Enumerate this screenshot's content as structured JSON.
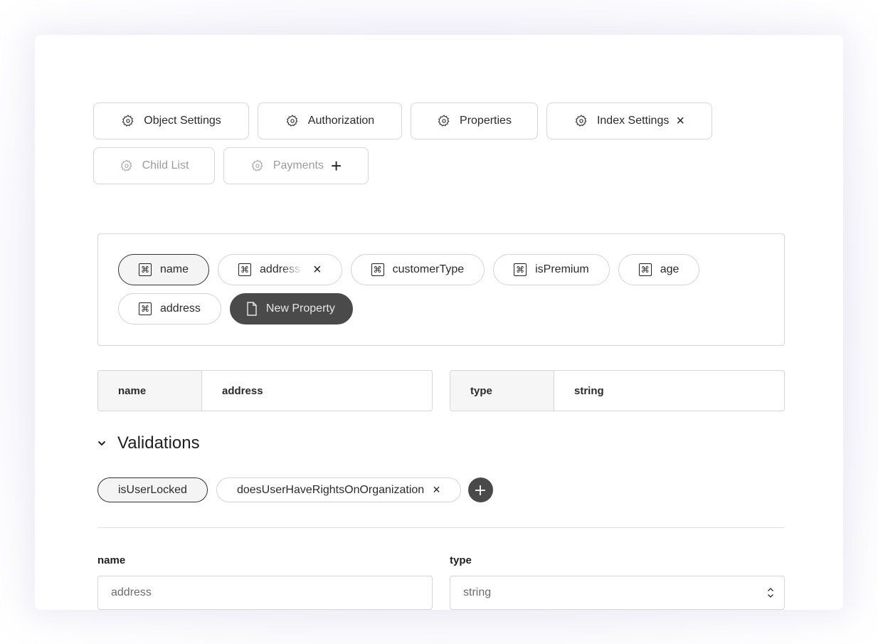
{
  "tabs": {
    "row1": [
      {
        "label": "Object Settings",
        "icon": "gear-icon",
        "state": "normal",
        "trailing": ""
      },
      {
        "label": "Authorization",
        "icon": "gear-icon",
        "state": "normal",
        "trailing": ""
      },
      {
        "label": "Properties",
        "icon": "gear-icon",
        "state": "normal",
        "trailing": ""
      },
      {
        "label": "Index Settings",
        "icon": "gear-icon",
        "state": "normal",
        "trailing": "×"
      }
    ],
    "row2": [
      {
        "label": "Child List",
        "icon": "gear-icon",
        "state": "disabled",
        "trailing": ""
      },
      {
        "label": "Payments",
        "icon": "gear-icon",
        "state": "disabled",
        "trailing": "+"
      }
    ]
  },
  "properties": {
    "items": [
      {
        "label": "name",
        "icon": "command-icon",
        "state": "active"
      },
      {
        "label": "address",
        "icon": "command-icon",
        "state": "editing",
        "close": "×"
      },
      {
        "label": "customerType",
        "icon": "command-icon",
        "state": "normal"
      },
      {
        "label": "isPremium",
        "icon": "command-icon",
        "state": "normal"
      },
      {
        "label": "age",
        "icon": "command-icon",
        "state": "normal"
      },
      {
        "label": "address",
        "icon": "command-icon",
        "state": "normal"
      }
    ],
    "new_button": {
      "label": "New Property",
      "icon": "file-icon"
    },
    "command_glyph": "⌘"
  },
  "summary": {
    "name_key": "name",
    "name_value": "address",
    "type_key": "type",
    "type_value": "string"
  },
  "validations": {
    "title": "Validations",
    "items": [
      {
        "label": "isUserLocked",
        "state": "active"
      },
      {
        "label": "doesUserHaveRightsOnOrganization",
        "state": "normal",
        "close": "×"
      }
    ]
  },
  "form": {
    "name_label": "name",
    "name_value": "address",
    "type_label": "type",
    "type_value": "string"
  }
}
